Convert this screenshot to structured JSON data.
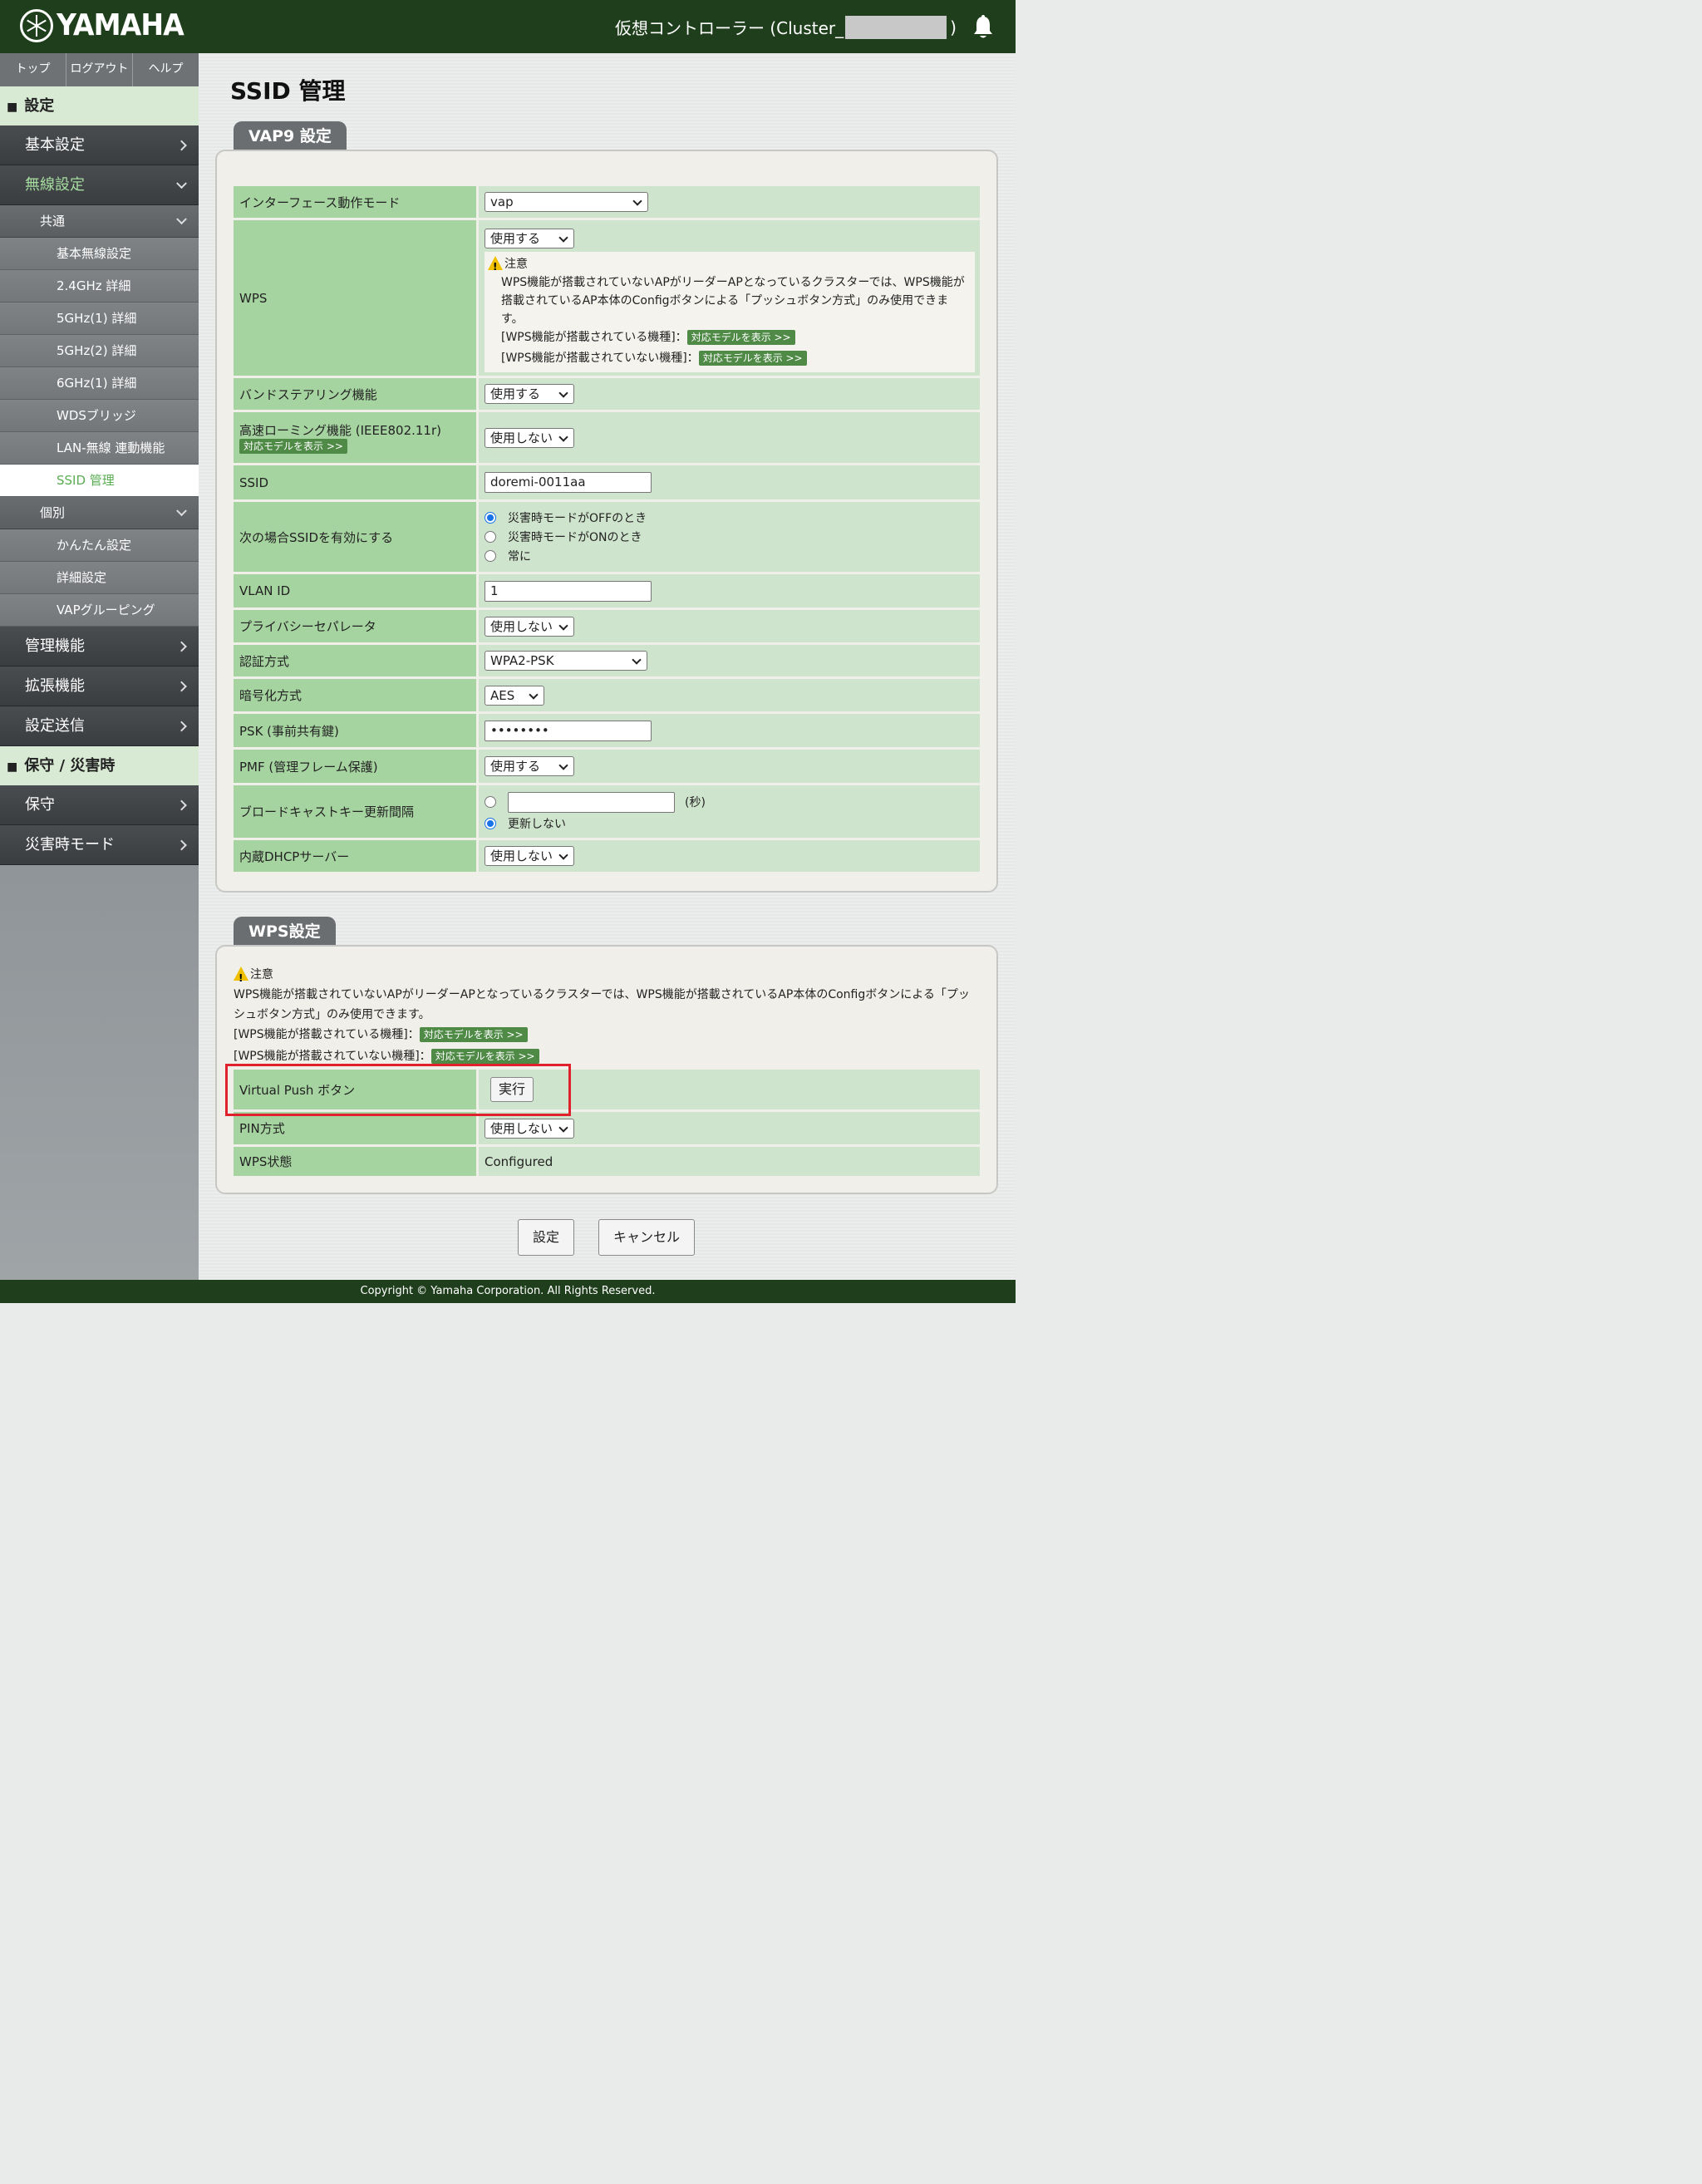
{
  "header": {
    "brand": "YAMAHA",
    "controller_prefix": "仮想コントローラー (Cluster_",
    "controller_suffix": ")"
  },
  "topnav": [
    "トップ",
    "ログアウト",
    "ヘルプ"
  ],
  "sidebar": {
    "section_settings": "設定",
    "basic": "基本設定",
    "wireless": "無線設定",
    "common": "共通",
    "common_items": [
      "基本無線設定",
      "2.4GHz 詳細",
      "5GHz(1) 詳細",
      "5GHz(2) 詳細",
      "6GHz(1) 詳細",
      "WDSブリッジ",
      "LAN-無線 連動機能",
      "SSID 管理"
    ],
    "individual": "個別",
    "individual_items": [
      "かんたん設定",
      "詳細設定",
      "VAPグルーピング"
    ],
    "mgmt": "管理機能",
    "ext": "拡張機能",
    "send": "設定送信",
    "section_maint": "保守 / 災害時",
    "maint": "保守",
    "disaster": "災害時モード"
  },
  "page_title": "SSID 管理",
  "vap": {
    "tab": "VAP9 設定",
    "if_mode_label": "インターフェース動作モード",
    "if_mode_value": "vap",
    "wps_label": "WPS",
    "wps_value": "使用する",
    "note_title": "注意",
    "note_text": "WPS機能が搭載されていないAPがリーダーAPとなっているクラスターでは、WPS機能が搭載されているAP本体のConfigボタンによる「プッシュボタン方式」のみ使用できます。",
    "note_equipped": "[WPS機能が搭載されている機種]：",
    "note_not_equipped": "[WPS機能が搭載されていない機種]：",
    "show_models": "対応モデルを表示 >>",
    "band_label": "バンドステアリング機能",
    "band_value": "使用する",
    "roam_label": "高速ローミング機能 (IEEE802.11r)",
    "roam_value": "使用しない",
    "ssid_label": "SSID",
    "ssid_value": "doremi-0011aa",
    "enable_label": "次の場合SSIDを有効にする",
    "enable_options": [
      "災害時モードがOFFのとき",
      "災害時モードがONのとき",
      "常に"
    ],
    "vlan_label": "VLAN ID",
    "vlan_value": "1",
    "privacy_label": "プライバシーセパレータ",
    "privacy_value": "使用しない",
    "auth_label": "認証方式",
    "auth_value": "WPA2-PSK",
    "enc_label": "暗号化方式",
    "enc_value": "AES",
    "psk_label": "PSK (事前共有鍵)",
    "psk_value": "••••••••",
    "pmf_label": "PMF (管理フレーム保護)",
    "pmf_value": "使用する",
    "bcast_label": "ブロードキャストキー更新間隔",
    "bcast_unit": "(秒)",
    "bcast_never": "更新しない",
    "dhcp_label": "内蔵DHCPサーバー",
    "dhcp_value": "使用しない"
  },
  "wps": {
    "tab": "WPS設定",
    "note_title": "注意",
    "note_text": "WPS機能が搭載されていないAPがリーダーAPとなっているクラスターでは、WPS機能が搭載されているAP本体のConfigボタンによる「プッシュボタン方式」のみ使用できます。",
    "note_equipped": "[WPS機能が搭載されている機種]：",
    "note_not_equipped": "[WPS機能が搭載されていない機種]：",
    "show_models": "対応モデルを表示 >>",
    "vpush_label": "Virtual Push ボタン",
    "vpush_button": "実行",
    "pin_label": "PIN方式",
    "pin_value": "使用しない",
    "state_label": "WPS状態",
    "state_value": "Configured"
  },
  "buttons": {
    "apply": "設定",
    "cancel": "キャンセル"
  },
  "footer": "Copyright © Yamaha Corporation. All Rights Reserved.",
  "colors": {
    "header_bg": "#1f3f1c",
    "label_bg": "#a6d4a0",
    "value_bg": "#cfe4cc",
    "highlight": "#e0202a",
    "accent_text": "#5aad52"
  }
}
